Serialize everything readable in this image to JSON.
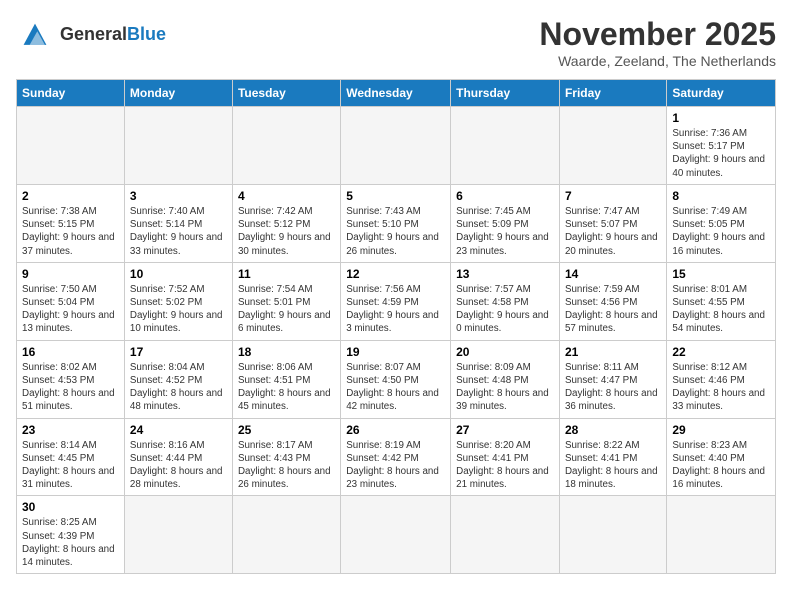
{
  "header": {
    "logo_text_general": "General",
    "logo_text_blue": "Blue",
    "month_title": "November 2025",
    "subtitle": "Waarde, Zeeland, The Netherlands"
  },
  "days_of_week": [
    "Sunday",
    "Monday",
    "Tuesday",
    "Wednesday",
    "Thursday",
    "Friday",
    "Saturday"
  ],
  "weeks": [
    [
      {
        "day": null,
        "info": null
      },
      {
        "day": null,
        "info": null
      },
      {
        "day": null,
        "info": null
      },
      {
        "day": null,
        "info": null
      },
      {
        "day": null,
        "info": null
      },
      {
        "day": null,
        "info": null
      },
      {
        "day": "1",
        "info": "Sunrise: 7:36 AM\nSunset: 5:17 PM\nDaylight: 9 hours and 40 minutes."
      }
    ],
    [
      {
        "day": "2",
        "info": "Sunrise: 7:38 AM\nSunset: 5:15 PM\nDaylight: 9 hours and 37 minutes."
      },
      {
        "day": "3",
        "info": "Sunrise: 7:40 AM\nSunset: 5:14 PM\nDaylight: 9 hours and 33 minutes."
      },
      {
        "day": "4",
        "info": "Sunrise: 7:42 AM\nSunset: 5:12 PM\nDaylight: 9 hours and 30 minutes."
      },
      {
        "day": "5",
        "info": "Sunrise: 7:43 AM\nSunset: 5:10 PM\nDaylight: 9 hours and 26 minutes."
      },
      {
        "day": "6",
        "info": "Sunrise: 7:45 AM\nSunset: 5:09 PM\nDaylight: 9 hours and 23 minutes."
      },
      {
        "day": "7",
        "info": "Sunrise: 7:47 AM\nSunset: 5:07 PM\nDaylight: 9 hours and 20 minutes."
      },
      {
        "day": "8",
        "info": "Sunrise: 7:49 AM\nSunset: 5:05 PM\nDaylight: 9 hours and 16 minutes."
      }
    ],
    [
      {
        "day": "9",
        "info": "Sunrise: 7:50 AM\nSunset: 5:04 PM\nDaylight: 9 hours and 13 minutes."
      },
      {
        "day": "10",
        "info": "Sunrise: 7:52 AM\nSunset: 5:02 PM\nDaylight: 9 hours and 10 minutes."
      },
      {
        "day": "11",
        "info": "Sunrise: 7:54 AM\nSunset: 5:01 PM\nDaylight: 9 hours and 6 minutes."
      },
      {
        "day": "12",
        "info": "Sunrise: 7:56 AM\nSunset: 4:59 PM\nDaylight: 9 hours and 3 minutes."
      },
      {
        "day": "13",
        "info": "Sunrise: 7:57 AM\nSunset: 4:58 PM\nDaylight: 9 hours and 0 minutes."
      },
      {
        "day": "14",
        "info": "Sunrise: 7:59 AM\nSunset: 4:56 PM\nDaylight: 8 hours and 57 minutes."
      },
      {
        "day": "15",
        "info": "Sunrise: 8:01 AM\nSunset: 4:55 PM\nDaylight: 8 hours and 54 minutes."
      }
    ],
    [
      {
        "day": "16",
        "info": "Sunrise: 8:02 AM\nSunset: 4:53 PM\nDaylight: 8 hours and 51 minutes."
      },
      {
        "day": "17",
        "info": "Sunrise: 8:04 AM\nSunset: 4:52 PM\nDaylight: 8 hours and 48 minutes."
      },
      {
        "day": "18",
        "info": "Sunrise: 8:06 AM\nSunset: 4:51 PM\nDaylight: 8 hours and 45 minutes."
      },
      {
        "day": "19",
        "info": "Sunrise: 8:07 AM\nSunset: 4:50 PM\nDaylight: 8 hours and 42 minutes."
      },
      {
        "day": "20",
        "info": "Sunrise: 8:09 AM\nSunset: 4:48 PM\nDaylight: 8 hours and 39 minutes."
      },
      {
        "day": "21",
        "info": "Sunrise: 8:11 AM\nSunset: 4:47 PM\nDaylight: 8 hours and 36 minutes."
      },
      {
        "day": "22",
        "info": "Sunrise: 8:12 AM\nSunset: 4:46 PM\nDaylight: 8 hours and 33 minutes."
      }
    ],
    [
      {
        "day": "23",
        "info": "Sunrise: 8:14 AM\nSunset: 4:45 PM\nDaylight: 8 hours and 31 minutes."
      },
      {
        "day": "24",
        "info": "Sunrise: 8:16 AM\nSunset: 4:44 PM\nDaylight: 8 hours and 28 minutes."
      },
      {
        "day": "25",
        "info": "Sunrise: 8:17 AM\nSunset: 4:43 PM\nDaylight: 8 hours and 26 minutes."
      },
      {
        "day": "26",
        "info": "Sunrise: 8:19 AM\nSunset: 4:42 PM\nDaylight: 8 hours and 23 minutes."
      },
      {
        "day": "27",
        "info": "Sunrise: 8:20 AM\nSunset: 4:41 PM\nDaylight: 8 hours and 21 minutes."
      },
      {
        "day": "28",
        "info": "Sunrise: 8:22 AM\nSunset: 4:41 PM\nDaylight: 8 hours and 18 minutes."
      },
      {
        "day": "29",
        "info": "Sunrise: 8:23 AM\nSunset: 4:40 PM\nDaylight: 8 hours and 16 minutes."
      }
    ],
    [
      {
        "day": "30",
        "info": "Sunrise: 8:25 AM\nSunset: 4:39 PM\nDaylight: 8 hours and 14 minutes."
      },
      {
        "day": null,
        "info": null
      },
      {
        "day": null,
        "info": null
      },
      {
        "day": null,
        "info": null
      },
      {
        "day": null,
        "info": null
      },
      {
        "day": null,
        "info": null
      },
      {
        "day": null,
        "info": null
      }
    ]
  ]
}
